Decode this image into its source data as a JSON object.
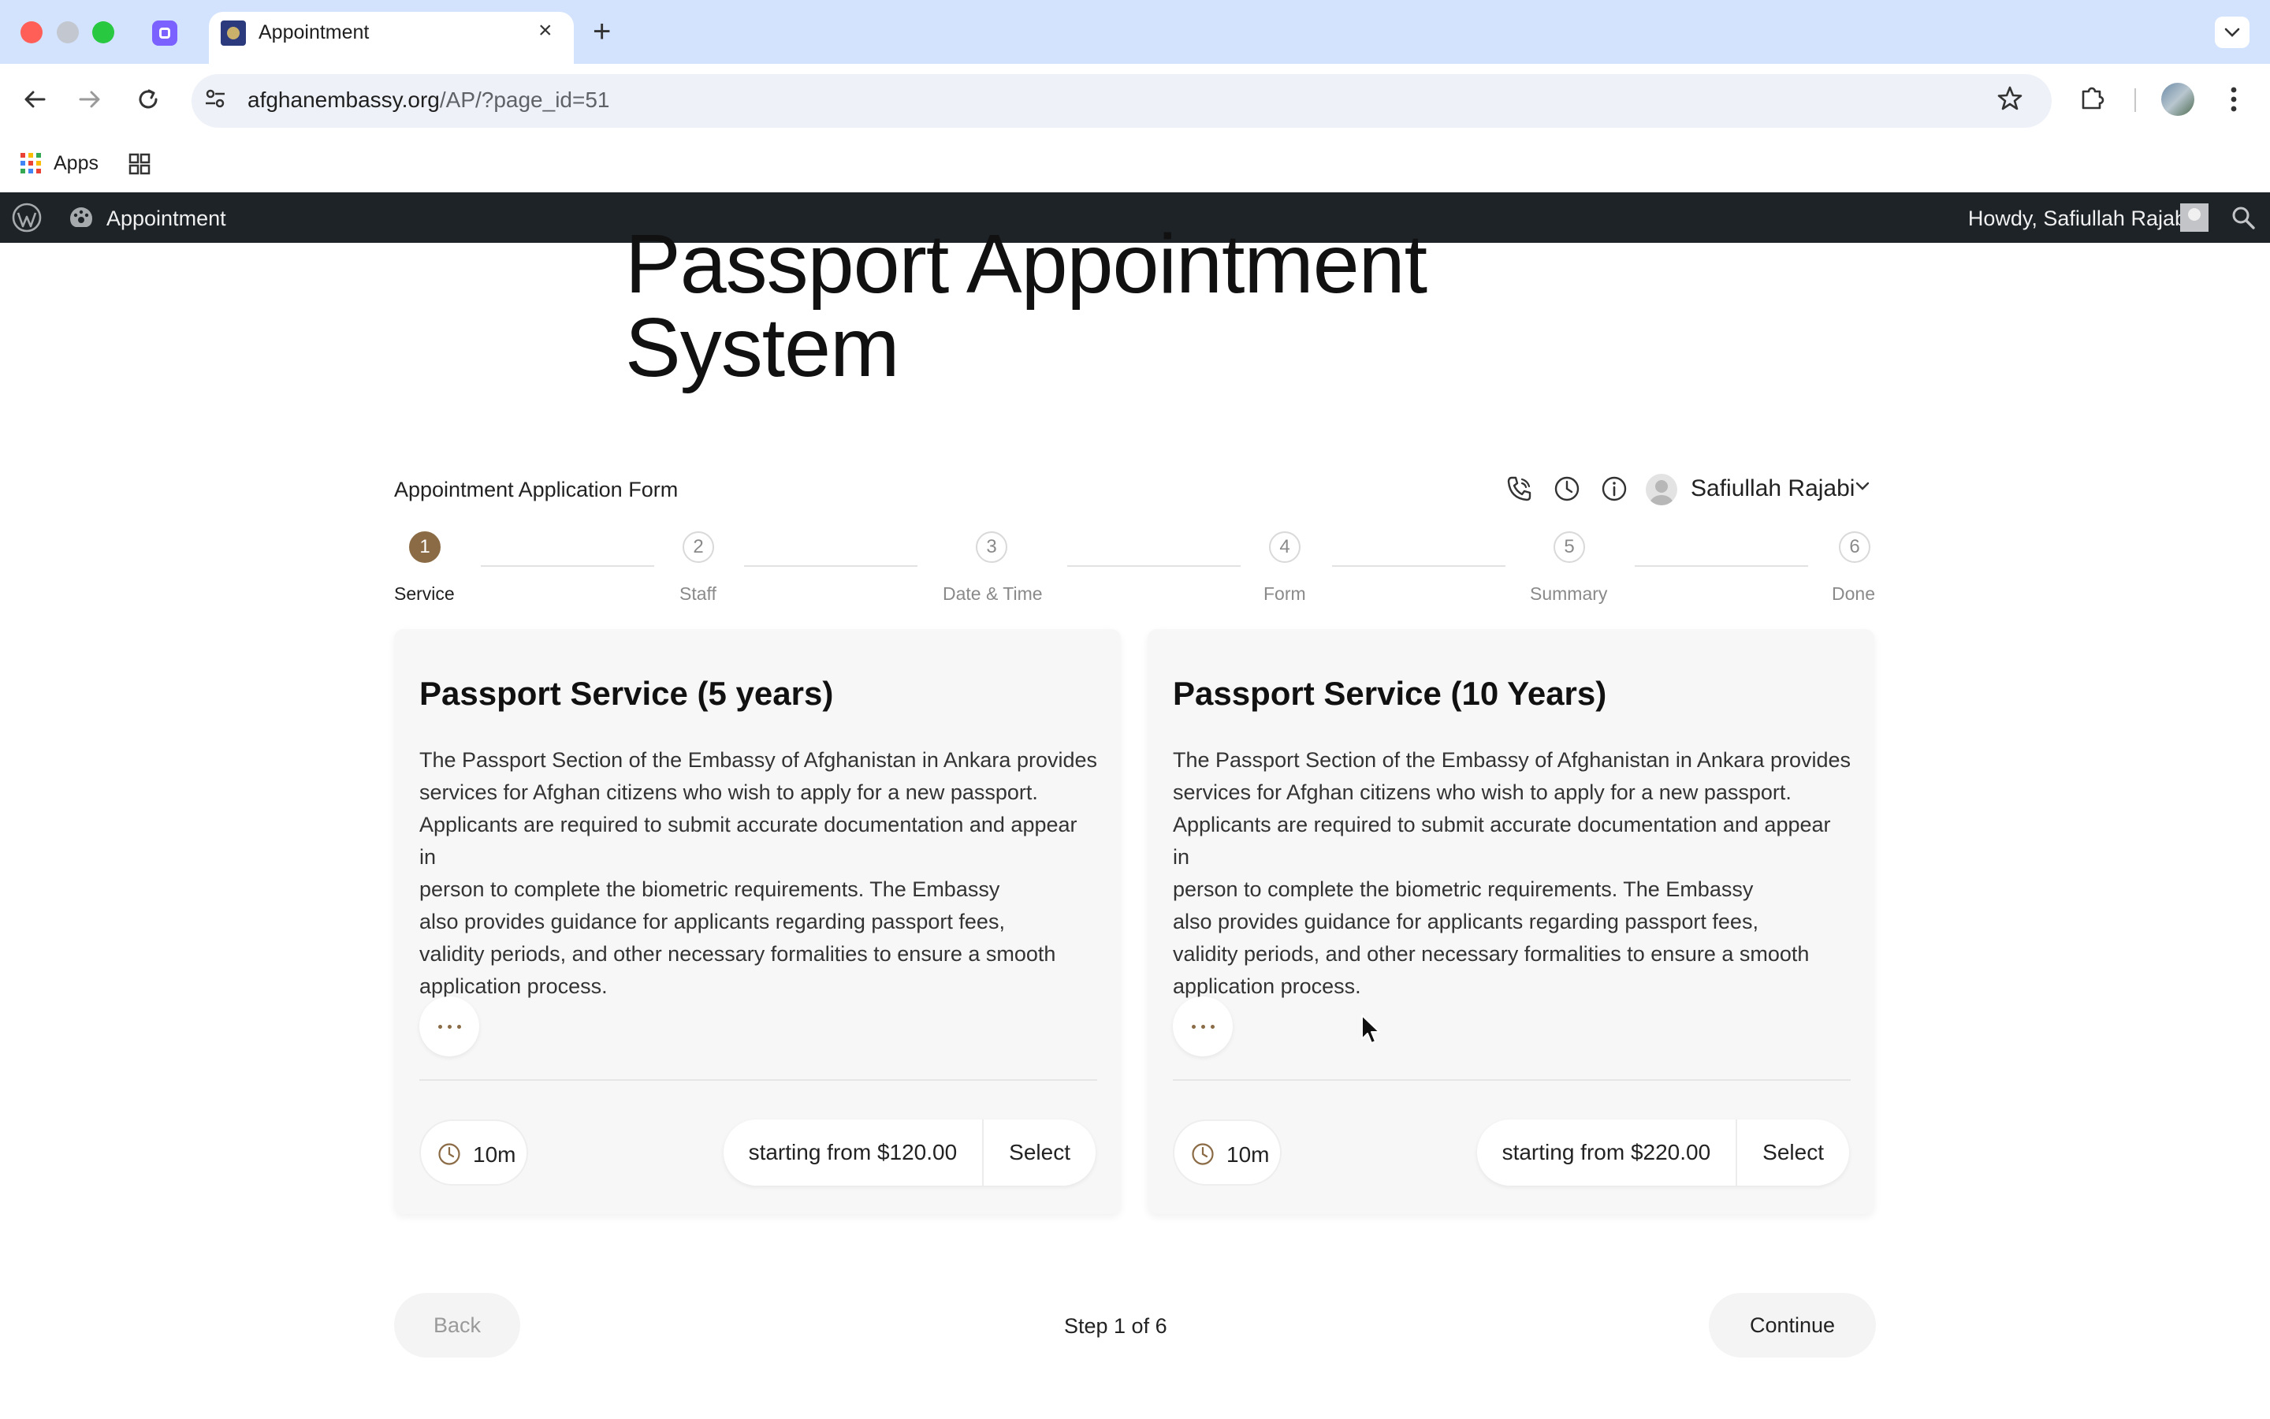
{
  "browser": {
    "tab_title": "Appointment",
    "tab_close": "×",
    "new_tab": "+",
    "url_host": "afghanembassy.org",
    "url_path": "/AP/?page_id=51",
    "bookmarks": {
      "apps_label": "Apps"
    }
  },
  "adminbar": {
    "site_name": "Appointment",
    "howdy": "Howdy, Safiullah Rajabi"
  },
  "page": {
    "title": "Passport Appointment System",
    "form_title": "Appointment Application Form",
    "user_name": "Safiullah Rajabi"
  },
  "steps": [
    {
      "number": "1",
      "label": "Service",
      "active": true
    },
    {
      "number": "2",
      "label": "Staff",
      "active": false
    },
    {
      "number": "3",
      "label": "Date & Time",
      "active": false
    },
    {
      "number": "4",
      "label": "Form",
      "active": false
    },
    {
      "number": "5",
      "label": "Summary",
      "active": false
    },
    {
      "number": "6",
      "label": "Done",
      "active": false
    }
  ],
  "services": [
    {
      "title": "Passport Service (5 years)",
      "description": "The Passport Section of the Embassy of Afghanistan in Ankara provides\nservices for Afghan citizens who wish to apply for a new passport.\nApplicants are required to submit accurate documentation and appear in\nperson to complete the biometric requirements. The Embassy\nalso provides guidance for applicants regarding passport fees,\nvalidity periods, and other necessary formalities to ensure a smooth\napplication process.",
      "duration": "10m",
      "price": "starting from $120.00",
      "select_label": "Select"
    },
    {
      "title": "Passport Service (10 Years)",
      "description": "The Passport Section of the Embassy of Afghanistan in Ankara provides\nservices for Afghan citizens who wish to apply for a new passport.\nApplicants are required to submit accurate documentation and appear in\nperson to complete the biometric requirements. The Embassy\nalso provides guidance for applicants regarding passport fees,\nvalidity periods, and other necessary formalities to ensure a smooth\napplication process.",
      "duration": "10m",
      "price": "starting from $220.00",
      "select_label": "Select"
    }
  ],
  "footer": {
    "back_label": "Back",
    "step_indicator": "Step 1 of 6",
    "continue_label": "Continue"
  },
  "colors": {
    "accent": "#8b6b45",
    "adminbar": "#1d2327",
    "tabbar": "#d3e3fd"
  }
}
